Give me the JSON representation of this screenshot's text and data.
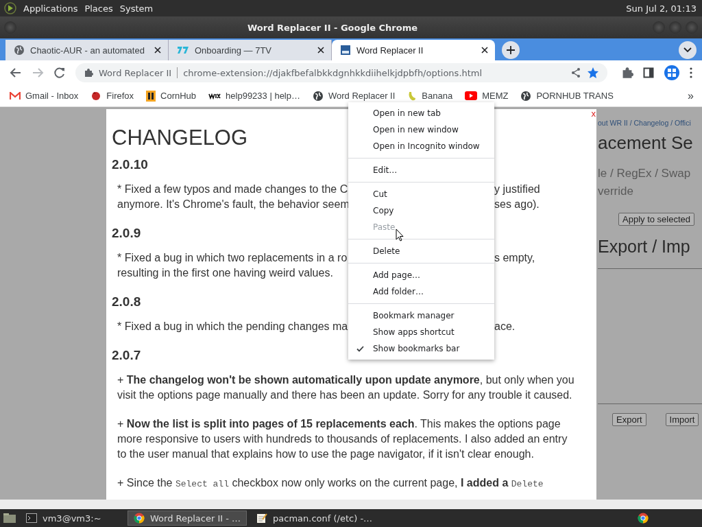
{
  "top_panel": {
    "menus": [
      "Applications",
      "Places",
      "System"
    ],
    "clock": "Sun Jul  2, 01:13"
  },
  "window": {
    "title": "Word Replacer II - Google Chrome"
  },
  "tabs": [
    {
      "title": "Chaotic-AUR - an automated",
      "selected": false
    },
    {
      "title": "Onboarding — 7TV",
      "selected": false
    },
    {
      "title": "Word Replacer II",
      "selected": true
    }
  ],
  "toolbar": {
    "site": "Word Replacer II",
    "url": "chrome-extension://djakfbefalbkkdgnhkkdiihelkjdpbfh/options.html"
  },
  "bookmarks": {
    "items": [
      "Gmail - Inbox",
      "Firefox",
      "CornHub",
      "help99233 | help…",
      "Word Replacer II",
      "Banana",
      "MEMZ",
      "PORNHUB TRANS"
    ],
    "more": "»"
  },
  "background_page": {
    "breadcrumb": "out WR II / Changelog / Offici",
    "heading": "acement Se",
    "modes": "le / RegEx / Swap",
    "modes_2": "verride",
    "apply_button": "Apply to selected",
    "export_heading": "Export / Imp",
    "export_button": "Export",
    "import_button": "Import"
  },
  "changelog": {
    "title": "CHANGELOG",
    "close": "x",
    "sections": [
      {
        "version": "2.0.10",
        "paragraphs": [
          {
            "kind": "split",
            "lines": [
              {
                "left": "* Fixed a few typos and made changes to the C",
                "right": "y justified"
              },
              {
                "left": "anymore. It's Chrome's fault, the behavior seem",
                "right": "ses ago)."
              }
            ]
          }
        ]
      },
      {
        "version": "2.0.9",
        "paragraphs": [
          {
            "kind": "split",
            "lines": [
              {
                "left": "* Fixed a bug in which two replacements in a ro",
                "right": "s empty,"
              },
              {
                "left": "resulting in the first one having weird values."
              }
            ]
          }
        ]
      },
      {
        "version": "2.0.8",
        "paragraphs": [
          {
            "kind": "split",
            "lines": [
              {
                "left": "* Fixed a bug in which the pending changes ma",
                "right": "ace."
              }
            ]
          }
        ]
      },
      {
        "version": "2.0.7",
        "paragraphs": [
          {
            "kind": "text",
            "text": "+ **The changelog won't be shown automatically upon update anymore**, but only when you visit the options page manually and there has been an update. Sorry for any trouble it caused."
          },
          {
            "kind": "text",
            "text": "+ **Now the list is split into pages of 15 replacements each**. This makes the options page more responsive to users with hundreds to thousands of replacements. I also added an entry to the user manual that explains how to use the page navigator, if it isn't clear enough."
          },
          {
            "kind": "segments",
            "segments": [
              {
                "text": "+ Since the ",
                "kind": "plain"
              },
              {
                "text": "Select all",
                "kind": "code"
              },
              {
                "text": " checkbox now only works on the current page, ",
                "kind": "plain"
              },
              {
                "text": "I added a ",
                "kind": "bold"
              },
              {
                "text": "Delete",
                "kind": "code"
              }
            ]
          }
        ]
      }
    ]
  },
  "context_menu": {
    "groups": [
      [
        {
          "label": "Open in new tab",
          "disabled": false,
          "checked": false
        },
        {
          "label": "Open in new window",
          "disabled": false,
          "checked": false
        },
        {
          "label": "Open in Incognito window",
          "disabled": false,
          "checked": false
        }
      ],
      [
        {
          "label": "Edit…",
          "disabled": false,
          "checked": false
        }
      ],
      [
        {
          "label": "Cut",
          "disabled": false,
          "checked": false
        },
        {
          "label": "Copy",
          "disabled": false,
          "checked": false
        },
        {
          "label": "Paste",
          "disabled": true,
          "checked": false
        }
      ],
      [
        {
          "label": "Delete",
          "disabled": false,
          "checked": false
        }
      ],
      [
        {
          "label": "Add page…",
          "disabled": false,
          "checked": false
        },
        {
          "label": "Add folder…",
          "disabled": false,
          "checked": false
        }
      ],
      [
        {
          "label": "Bookmark manager",
          "disabled": false,
          "checked": false
        },
        {
          "label": "Show apps shortcut",
          "disabled": false,
          "checked": false
        },
        {
          "label": "Show bookmarks bar",
          "disabled": false,
          "checked": true
        }
      ]
    ]
  },
  "taskbar": {
    "items": [
      {
        "label": "vm3@vm3:~",
        "selected": false
      },
      {
        "label": "Word Replacer II - …",
        "selected": true
      },
      {
        "label": "pacman.conf (/etc) -…",
        "selected": false
      }
    ]
  }
}
